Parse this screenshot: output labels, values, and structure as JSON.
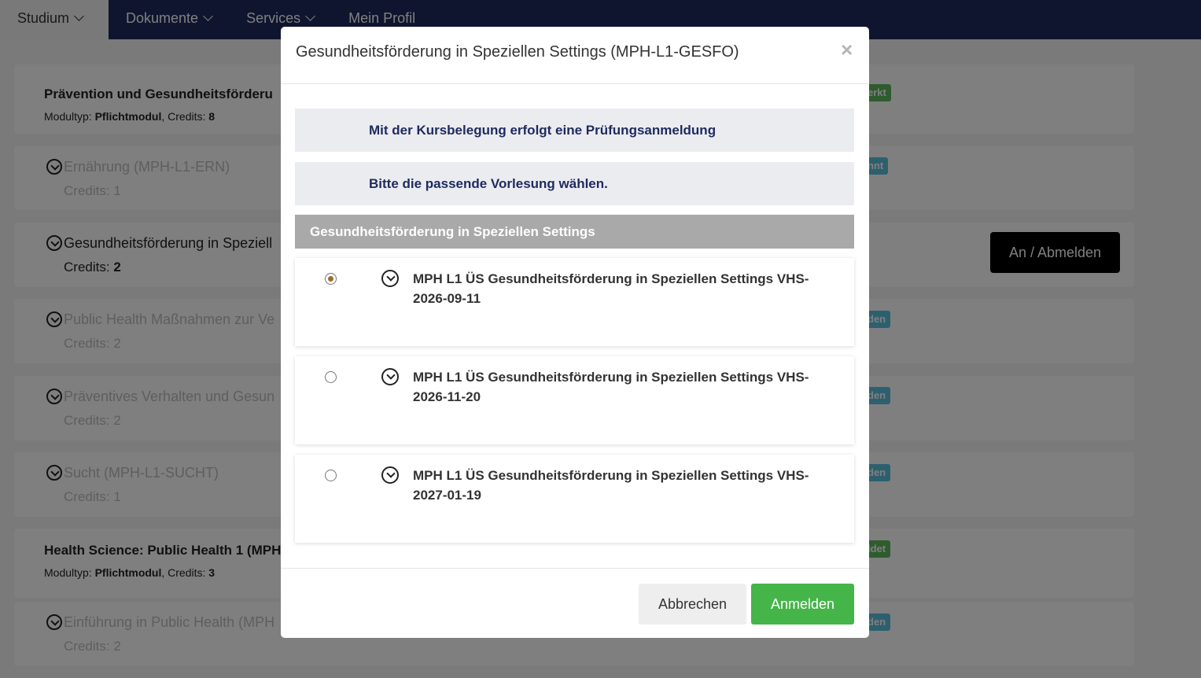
{
  "nav": {
    "items": [
      {
        "label": "Studium",
        "has_dropdown": true,
        "active": true
      },
      {
        "label": "Dokumente",
        "has_dropdown": true,
        "active": false
      },
      {
        "label": "Services",
        "has_dropdown": true,
        "active": false
      },
      {
        "label": "Mein Profil",
        "has_dropdown": false,
        "active": false
      }
    ]
  },
  "background": {
    "modules": [
      {
        "title": "Prävention und Gesundheitsförderu",
        "type_label": "Modultyp:",
        "type": "Pflichtmodul",
        "credits_label": "Credits:",
        "credits": "8",
        "badge": "erkt"
      },
      {
        "title": "Health Science: Public Health 1 (MPH",
        "type_label": "Modultyp:",
        "type": "Pflichtmodul",
        "credits_label": "Credits:",
        "credits": "3",
        "badge": "ldet"
      }
    ],
    "courses": [
      {
        "title": "Ernährung (MPH-L1-ERN)",
        "credits_label": "Credits:",
        "credits": "1",
        "badge": "nnt"
      },
      {
        "title": "Gesundheitsförderung in Speziell",
        "credits_label": "Credits:",
        "credits": "2",
        "action": "An / Abmelden"
      },
      {
        "title": "Public Health Maßnahmen zur Ve",
        "credits_label": "Credits:",
        "credits": "2",
        "badge": "den"
      },
      {
        "title": "Präventives Verhalten und Gesun",
        "credits_label": "Credits:",
        "credits": "2",
        "badge": "den"
      },
      {
        "title": "Sucht (MPH-L1-SUCHT)",
        "credits_label": "Credits:",
        "credits": "1",
        "badge": "den"
      },
      {
        "title": "Einführung in Public Health (MPH",
        "credits_label": "Credits:",
        "credits": "2",
        "badge": "den"
      }
    ],
    "colors": {
      "nav": "#1e2a5e",
      "badge_green": "#5cb85c",
      "badge_blue": "#5bc0de"
    }
  },
  "modal": {
    "title": "Gesundheitsförderung in Speziellen Settings (MPH-L1-GESFO)",
    "close": "×",
    "info_1": "Mit der Kursbelegung erfolgt eine Prüfungsanmeldung",
    "info_2": "Bitte die passende Vorlesung wählen.",
    "group_title": "Gesundheitsförderung in Speziellen Settings",
    "options": [
      {
        "label": "MPH L1 ÜS Gesundheitsförderung in Speziellen Settings VHS-2026-09-11",
        "selected": true
      },
      {
        "label": "MPH L1 ÜS Gesundheitsförderung in Speziellen Settings VHS-2026-11-20",
        "selected": false
      },
      {
        "label": "MPH L1 ÜS Gesundheitsförderung in Speziellen Settings VHS-2027-01-19",
        "selected": false
      }
    ],
    "cancel_label": "Abbrechen",
    "submit_label": "Anmelden",
    "colors": {
      "submit": "#45b549",
      "info_text": "#1e2a5e",
      "group_head": "#a9a9a9"
    }
  }
}
